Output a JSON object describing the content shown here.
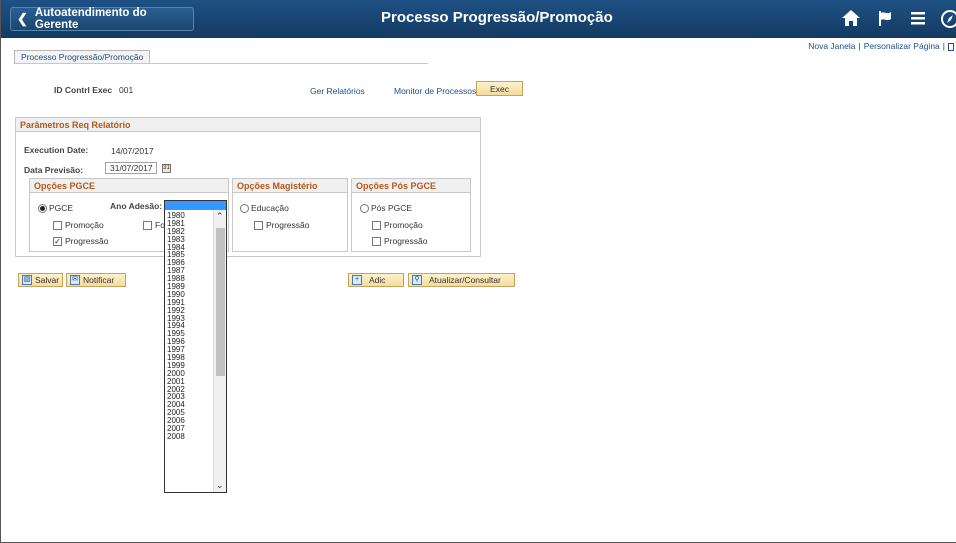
{
  "header": {
    "back_label": "Autoatendimento do Gerente",
    "title": "Processo Progressão/Promoção"
  },
  "top_links": {
    "new_window": "Nova Janela",
    "personalize": "Personalizar Página"
  },
  "tab": {
    "label": "Processo Progressão/Promoção"
  },
  "run_control": {
    "label": "ID Contrl Exec",
    "value": "001"
  },
  "links": {
    "report_manager": "Ger Relatórios",
    "process_monitor": "Monitor de Processos"
  },
  "exec_button": "Exec",
  "params": {
    "title": "Parâmetros Req Relatório",
    "execution_date_label": "Execution Date:",
    "execution_date_value": "14/07/2017",
    "forecast_date_label": "Data Previsão:",
    "forecast_date_value": "31/07/2017"
  },
  "pgce": {
    "title": "Opções PGCE",
    "radio_label": "PGCE",
    "year_label": "Ano Adesão:",
    "promotion": "Promoção",
    "partial_option": "Fo",
    "progression": "Progressão"
  },
  "magisterio": {
    "title": "Opções Magistério",
    "radio_label": "Educação",
    "progression": "Progressão"
  },
  "pos_pgce": {
    "title": "Opções Pós PGCE",
    "radio_label": "Pós PGCE",
    "promotion": "Promoção",
    "progression": "Progressão"
  },
  "buttons": {
    "save": "Salvar",
    "notify": "Notificar",
    "add": "Adic",
    "update": "Atualizar/Consultar"
  },
  "year_options": [
    "1980",
    "1981",
    "1982",
    "1983",
    "1984",
    "1985",
    "1986",
    "1987",
    "1988",
    "1989",
    "1990",
    "1991",
    "1992",
    "1993",
    "1994",
    "1995",
    "1996",
    "1997",
    "1998",
    "1999",
    "2000",
    "2001",
    "2002",
    "2003",
    "2004",
    "2005",
    "2006",
    "2007",
    "2008"
  ],
  "icons": {
    "back": "chevron-left-icon",
    "home": "home-icon",
    "flag": "flag-icon",
    "menu": "menu-icon",
    "nav": "compass-icon"
  },
  "colors": {
    "banner": "#1f5184",
    "section_title": "#b5581b",
    "link": "#1b4f8a",
    "button": "#f4dc9e"
  }
}
